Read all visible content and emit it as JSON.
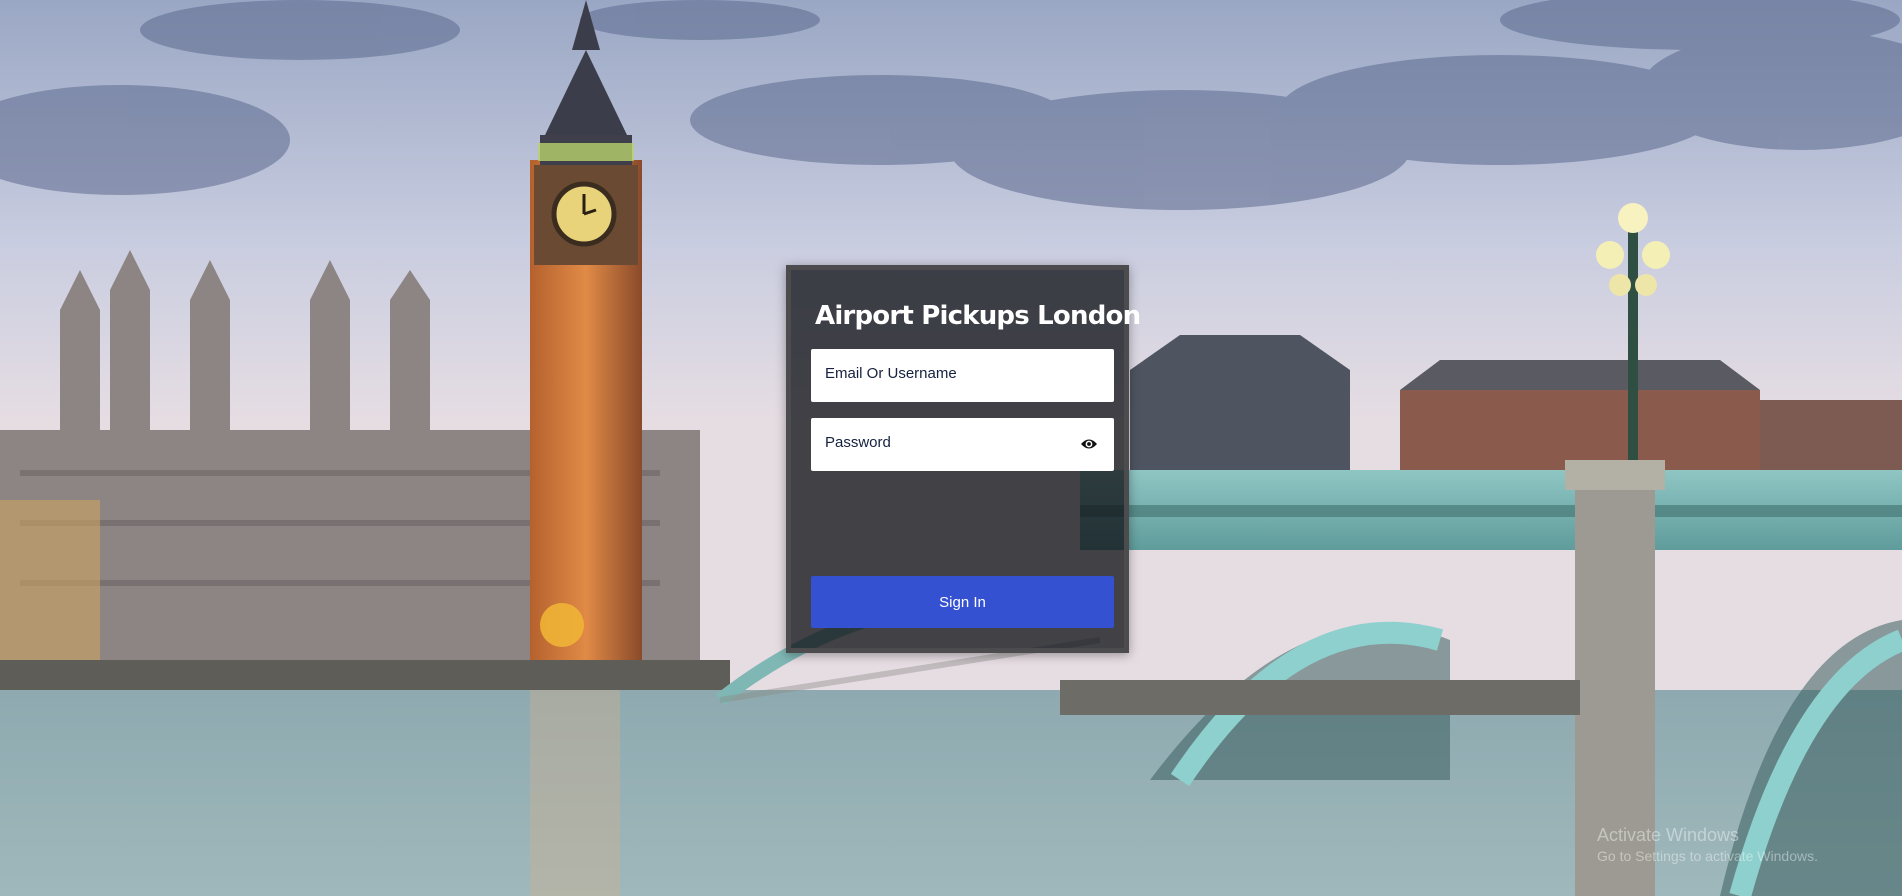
{
  "brand": {
    "name": "Airport Pickups London"
  },
  "login": {
    "email_label": "Email Or Username",
    "password_label": "Password",
    "sign_in_label": "Sign In"
  },
  "watermark": {
    "title": "Activate Windows",
    "subtitle": "Go to Settings to activate Windows."
  },
  "colors": {
    "button_bg": "#3451d1",
    "panel_border": "#4c4c4f",
    "field_text": "#15213f"
  }
}
